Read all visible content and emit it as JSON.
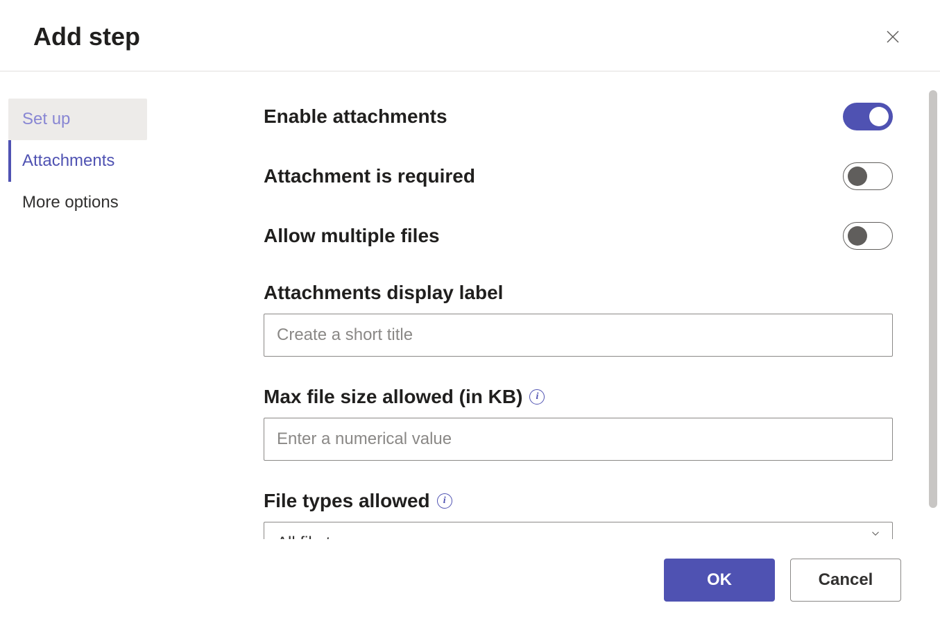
{
  "header": {
    "title": "Add step"
  },
  "sidebar": {
    "items": [
      {
        "label": "Set up",
        "state": "setup"
      },
      {
        "label": "Attachments",
        "state": "active"
      },
      {
        "label": "More options",
        "state": ""
      }
    ]
  },
  "main": {
    "toggles": [
      {
        "label": "Enable attachments",
        "on": true
      },
      {
        "label": "Attachment is required",
        "on": false
      },
      {
        "label": "Allow multiple files",
        "on": false
      }
    ],
    "display_label": {
      "label": "Attachments display label",
      "placeholder": "Create a short title",
      "value": ""
    },
    "max_size": {
      "label": "Max file size allowed (in KB)",
      "placeholder": "Enter a numerical value",
      "value": ""
    },
    "file_types": {
      "label": "File types allowed",
      "selected": "All file types"
    }
  },
  "footer": {
    "ok": "OK",
    "cancel": "Cancel"
  },
  "colors": {
    "accent": "#4f52b2"
  }
}
